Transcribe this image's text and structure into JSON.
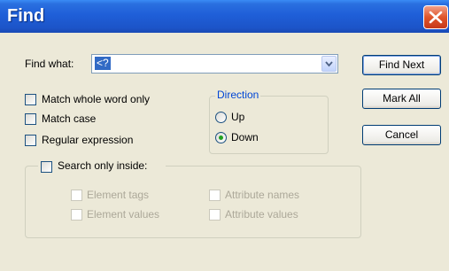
{
  "window": {
    "title": "Find"
  },
  "find_what": {
    "label": "Find what:",
    "value": "<?"
  },
  "buttons": {
    "find_next": "Find Next",
    "mark_all": "Mark All",
    "cancel": "Cancel"
  },
  "options": {
    "match_whole_word": {
      "label": "Match whole word only",
      "checked": false
    },
    "match_case": {
      "label": "Match case",
      "checked": false
    },
    "regular_expression": {
      "label": "Regular expression",
      "checked": false
    }
  },
  "direction": {
    "title": "Direction",
    "up": {
      "label": "Up",
      "selected": false
    },
    "down": {
      "label": "Down",
      "selected": true
    }
  },
  "search_inside": {
    "label": "Search only inside:",
    "checked": false,
    "element_tags": "Element tags",
    "element_values": "Element values",
    "attribute_names": "Attribute names",
    "attribute_values": "Attribute values"
  },
  "colors": {
    "title_bar": "#1f5fd8",
    "dialog_bg": "#ece9d8",
    "selection": "#316ac5",
    "direction_title": "#0046d5"
  }
}
